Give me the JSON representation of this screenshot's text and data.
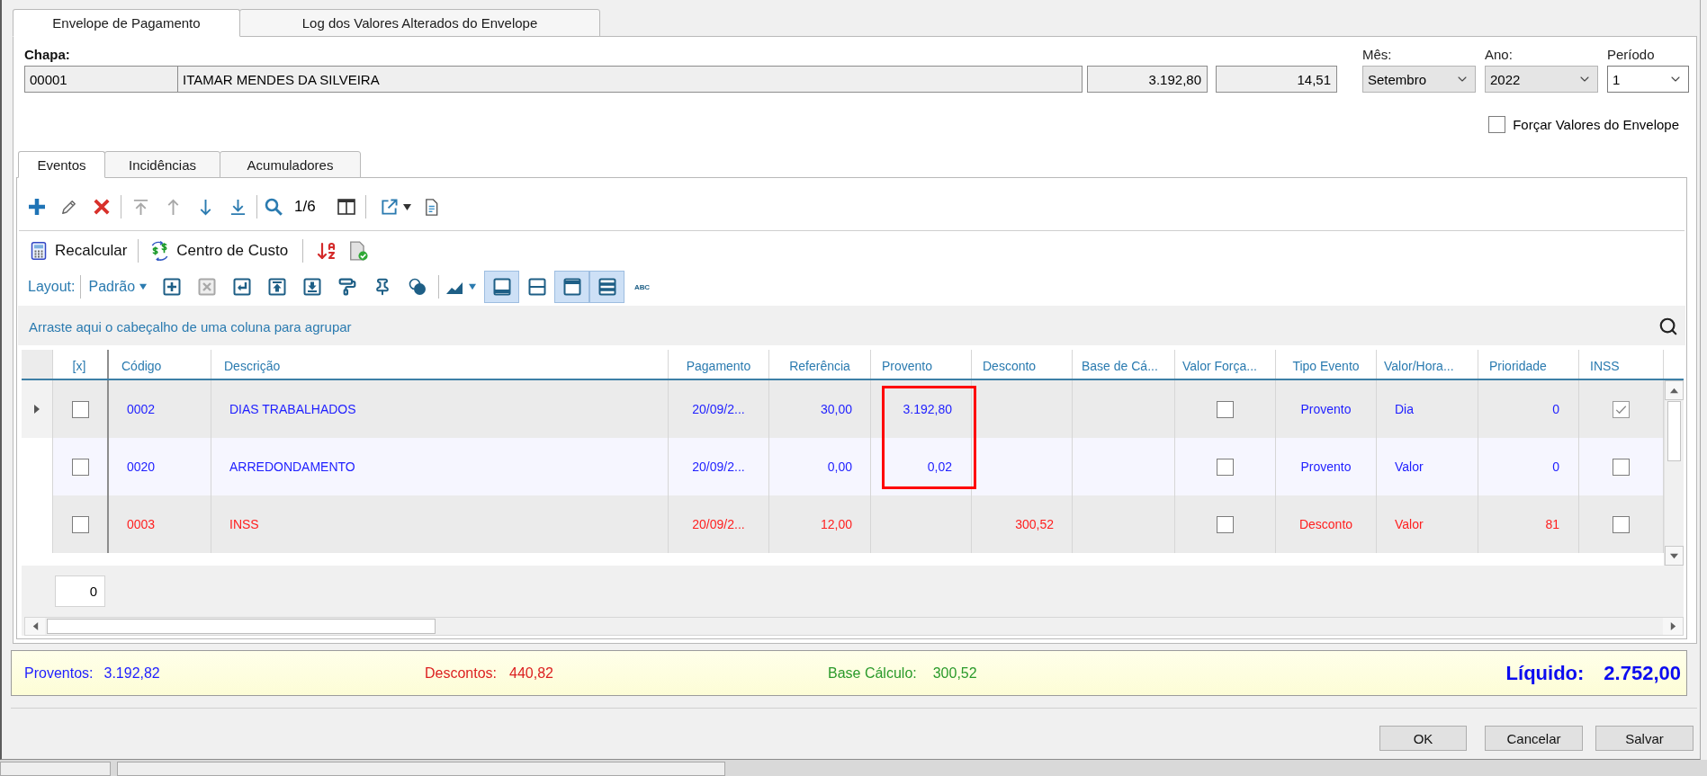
{
  "window_tabs": [
    {
      "label": "Envelope de Pagamento",
      "selected": true
    },
    {
      "label": "Log dos Valores Alterados do Envelope",
      "selected": false
    }
  ],
  "employee": {
    "label": "Chapa:",
    "chapa": "00001",
    "name": "ITAMAR MENDES DA SILVEIRA",
    "field_3": "3.192,80",
    "field_4": "14,51"
  },
  "period_selects": [
    {
      "label": "Mês:",
      "value": "Setembro",
      "disabled": true
    },
    {
      "label": "Ano:",
      "value": "2022",
      "disabled": true
    },
    {
      "label": "Período",
      "value": "1",
      "disabled": false
    }
  ],
  "force_values": {
    "label": "Forçar Valores do Envelope",
    "checked": false
  },
  "inner_tabs": [
    {
      "label": "Eventos",
      "selected": true
    },
    {
      "label": "Incidências",
      "selected": false
    },
    {
      "label": "Acumuladores",
      "selected": false
    }
  ],
  "toolbar": {
    "navigation": [
      {
        "disabled": true
      },
      {
        "disabled": true
      },
      {
        "disabled": false
      },
      {
        "disabled": false
      }
    ],
    "record_position": "1/6"
  },
  "actions": {
    "recalculate": "Recalcular",
    "cost_center": "Centro de Custo"
  },
  "layout_bar": {
    "label": "Layout:",
    "preset": "Padrão",
    "tools": [
      {
        "disabled": false
      },
      {
        "disabled": true
      },
      {
        "disabled": false
      },
      {
        "disabled": false
      },
      {
        "disabled": false
      },
      {
        "disabled": false
      },
      {
        "disabled": false
      },
      {
        "disabled": false
      }
    ],
    "row_styles": [
      {
        "selected": true
      },
      {
        "selected": false
      },
      {
        "selected": true
      },
      {
        "selected": true
      }
    ],
    "text_style": "ABC"
  },
  "group_panel": {
    "hint": "Arraste aqui o cabeçalho de uma coluna para agrupar"
  },
  "table": {
    "columns": [
      {
        "label": "[x]",
        "framed": false
      },
      {
        "label": "Código",
        "framed": false
      },
      {
        "label": "Descrição",
        "framed": false
      },
      {
        "label": "Pagamento",
        "framed": false
      },
      {
        "label": "Referência",
        "framed": false
      },
      {
        "label": "Provento",
        "framed": true
      },
      {
        "label": "Desconto",
        "framed": false
      },
      {
        "label": "Base de Cá...",
        "framed": false
      },
      {
        "label": "Valor Força...",
        "framed": false
      },
      {
        "label": "Tipo Evento",
        "framed": false
      },
      {
        "label": "Valor/Hora...",
        "framed": false
      },
      {
        "label": "Prioridade",
        "framed": false
      },
      {
        "label": "INSS",
        "framed": false
      }
    ],
    "rows": [
      {
        "selected": true,
        "framed": true,
        "color": "#1e1eff",
        "checked": false,
        "codigo": "0002",
        "descricao": "DIAS TRABALHADOS",
        "pagamento": "20/09/2...",
        "referencia": "30,00",
        "provento": "3.192,80",
        "valor_forcado": false,
        "tipo_evento": "Provento",
        "valor_hora": "Dia",
        "prioridade": "0",
        "inss": true
      },
      {
        "selected": false,
        "framed": true,
        "color": "#1e1eff",
        "checked": false,
        "codigo": "0020",
        "descricao": "ARREDONDAMENTO",
        "pagamento": "20/09/2...",
        "referencia": "0,00",
        "provento": "0,02",
        "valor_forcado": false,
        "tipo_evento": "Provento",
        "valor_hora": "Valor",
        "prioridade": "0",
        "inss": false
      },
      {
        "selected": false,
        "framed": false,
        "color": "#ff1e1e",
        "checked": false,
        "codigo": "0003",
        "descricao": "INSS",
        "pagamento": "20/09/2...",
        "referencia": "12,00",
        "desconto": "300,52",
        "valor_forcado": false,
        "tipo_evento": "Desconto",
        "valor_hora": "Valor",
        "prioridade": "81",
        "inss": false
      }
    ],
    "footer_count": "0"
  },
  "summary": {
    "proventos_label": "Proventos:",
    "proventos": "3.192,82",
    "descontos_label": "Descontos:",
    "descontos": "440,82",
    "base_label": "Base Cálculo:",
    "base": "300,52",
    "liquido_label": "Líquido:",
    "liquido": "2.752,00"
  },
  "buttons": [
    "OK",
    "Cancelar",
    "Salvar"
  ]
}
